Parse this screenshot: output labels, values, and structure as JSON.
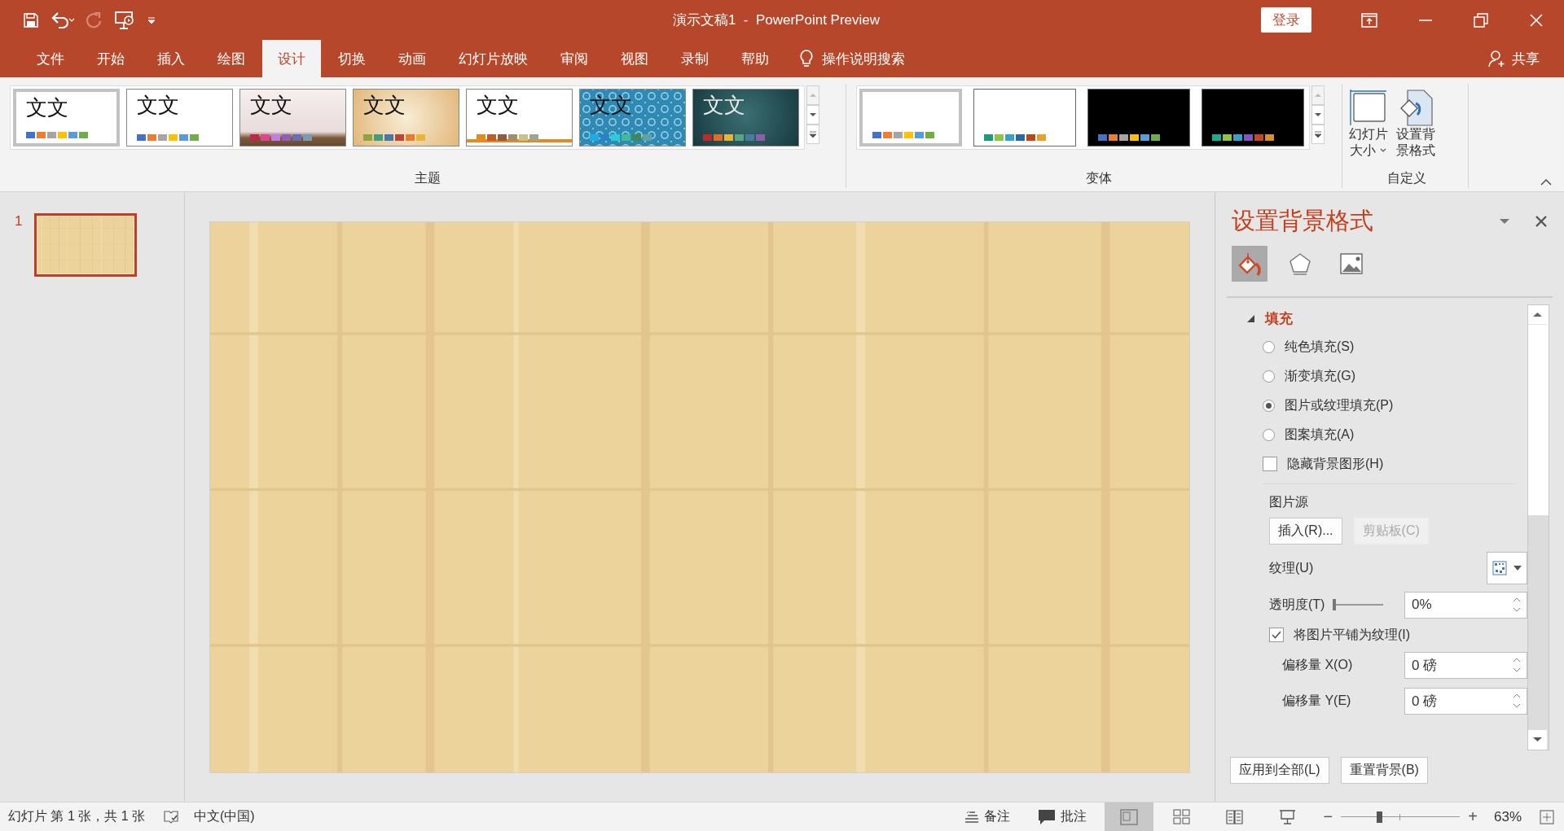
{
  "window": {
    "title": "演示文稿1  -  PowerPoint Preview",
    "sign_in": "登录"
  },
  "tabs": [
    {
      "label": "文件",
      "selected": false
    },
    {
      "label": "开始",
      "selected": false
    },
    {
      "label": "插入",
      "selected": false
    },
    {
      "label": "绘图",
      "selected": false
    },
    {
      "label": "设计",
      "selected": true
    },
    {
      "label": "切换",
      "selected": false
    },
    {
      "label": "动画",
      "selected": false
    },
    {
      "label": "幻灯片放映",
      "selected": false
    },
    {
      "label": "审阅",
      "selected": false
    },
    {
      "label": "视图",
      "selected": false
    },
    {
      "label": "录制",
      "selected": false
    },
    {
      "label": "帮助",
      "selected": false
    }
  ],
  "tell_me": "操作说明搜索",
  "share": "共享",
  "ribbon": {
    "themes": {
      "label": "主题",
      "items": [
        {
          "kind": "plain",
          "sample": "文文",
          "selected": true,
          "swatches": [
            {
              "color": "#4472c4"
            },
            {
              "color": "#ed7d31"
            },
            {
              "color": "#a5a5a5"
            },
            {
              "color": "#ffc000"
            },
            {
              "color": "#5b9bd5"
            },
            {
              "color": "#70ad47"
            }
          ]
        },
        {
          "kind": "plain",
          "sample": "文文",
          "selected": false,
          "swatches": [
            {
              "color": "#4472c4"
            },
            {
              "color": "#ed7d31"
            },
            {
              "color": "#a5a5a5"
            },
            {
              "color": "#ffc000"
            },
            {
              "color": "#5b9bd5"
            },
            {
              "color": "#70ad47"
            }
          ]
        },
        {
          "kind": "blush",
          "sample": "文文",
          "selected": false,
          "swatches": [
            {
              "color": "#c0264a"
            },
            {
              "color": "#e0468b"
            },
            {
              "color": "#c27ce8"
            },
            {
              "color": "#8e5fb5"
            },
            {
              "color": "#6a6fb5"
            },
            {
              "color": "#7d9bb0"
            }
          ]
        },
        {
          "kind": "tan",
          "sample": "文文",
          "selected": false,
          "swatches": [
            {
              "color": "#8da53a"
            },
            {
              "color": "#3f9e7d"
            },
            {
              "color": "#4a77a8"
            },
            {
              "color": "#b8473a"
            },
            {
              "color": "#e07f2e"
            },
            {
              "color": "#e8b53a"
            }
          ]
        },
        {
          "kind": "line",
          "sample": "文文",
          "selected": false,
          "swatches": [
            {
              "color": "#e58a1e"
            },
            {
              "color": "#c05a27"
            },
            {
              "color": "#8f5c40"
            },
            {
              "color": "#a58c6a"
            },
            {
              "color": "#c8c28a"
            },
            {
              "color": "#9ea58e"
            }
          ]
        },
        {
          "kind": "pattern",
          "sample": "文文",
          "selected": false,
          "swatches": [
            {
              "color": "#1cade4"
            },
            {
              "color": "#2683c6"
            },
            {
              "color": "#27ced7"
            },
            {
              "color": "#42ba97"
            },
            {
              "color": "#3e8853"
            },
            {
              "color": "#62a39f"
            }
          ]
        },
        {
          "kind": "teal",
          "sample": "文文",
          "selected": false,
          "swatches": [
            {
              "color": "#c0292a"
            },
            {
              "color": "#e06d22"
            },
            {
              "color": "#e8b53a"
            },
            {
              "color": "#5aa581"
            },
            {
              "color": "#4a7aa0"
            },
            {
              "color": "#8e5fa8"
            }
          ]
        }
      ]
    },
    "variants": {
      "label": "变体",
      "items": [
        {
          "kind": "light",
          "selected": true,
          "swatches": [
            {
              "color": "#4472c4"
            },
            {
              "color": "#ed7d31"
            },
            {
              "color": "#a5a5a5"
            },
            {
              "color": "#ffc000"
            },
            {
              "color": "#5b9bd5"
            },
            {
              "color": "#70ad47"
            }
          ]
        },
        {
          "kind": "light",
          "selected": false,
          "swatches": [
            {
              "color": "#1d9a78"
            },
            {
              "color": "#8dc63f"
            },
            {
              "color": "#35a2c8"
            },
            {
              "color": "#2269a8"
            },
            {
              "color": "#b8471e"
            },
            {
              "color": "#e8a02b"
            }
          ]
        },
        {
          "kind": "dark",
          "selected": false,
          "swatches": [
            {
              "color": "#4472c4"
            },
            {
              "color": "#ed7d31"
            },
            {
              "color": "#a5a5a5"
            },
            {
              "color": "#ffc000"
            },
            {
              "color": "#5b9bd5"
            },
            {
              "color": "#70ad47"
            }
          ]
        },
        {
          "kind": "dark",
          "selected": false,
          "swatches": [
            {
              "color": "#1cad8e"
            },
            {
              "color": "#8dc63f"
            },
            {
              "color": "#35a2c8"
            },
            {
              "color": "#7d58c0"
            },
            {
              "color": "#c0462c"
            },
            {
              "color": "#d98e2e"
            }
          ]
        }
      ]
    },
    "customize": {
      "label": "自定义",
      "buttons": [
        {
          "kind": "slide-size",
          "lines": [
            "幻灯片",
            "大小"
          ],
          "dropdown": true
        },
        {
          "kind": "format-background",
          "lines": [
            "设置背",
            "景格式"
          ],
          "dropdown": false
        }
      ]
    }
  },
  "slides": [
    {
      "number": "1",
      "selected": true
    }
  ],
  "slide": {
    "kind": "picture"
  },
  "pane": {
    "title": "设置背景格式",
    "icon_tabs": [
      {
        "kind": "fill",
        "selected": true
      },
      {
        "kind": "effects",
        "selected": false
      },
      {
        "kind": "picture",
        "selected": false
      }
    ],
    "section": {
      "label": "填充",
      "expanded": true
    },
    "options": [
      {
        "kind": "radio",
        "label": "纯色填充(S)",
        "selected": false
      },
      {
        "kind": "radio",
        "label": "渐变填充(G)",
        "selected": false
      },
      {
        "kind": "radio",
        "label": "图片或纹理填充(P)",
        "selected": true
      },
      {
        "kind": "radio",
        "label": "图案填充(A)",
        "selected": false
      },
      {
        "kind": "checkbox",
        "label": "隐藏背景图形(H)",
        "checked": false
      }
    ],
    "picture_source": {
      "label": "图片源",
      "buttons": [
        {
          "label": "插入(R)...",
          "disabled": false
        },
        {
          "label": "剪贴板(C)",
          "disabled": true
        }
      ]
    },
    "texture": {
      "label": "纹理(U)"
    },
    "transparency": {
      "label": "透明度(T)",
      "level": 0,
      "value": "0%"
    },
    "tile": {
      "label": "将图片平铺为纹理(I)",
      "checked": true
    },
    "offsets": [
      {
        "label": "偏移量 X(O)",
        "value": "0 磅"
      },
      {
        "label": "偏移量 Y(E)",
        "value": "0 磅"
      }
    ],
    "footer_buttons": [
      "应用到全部(L)",
      "重置背景(B)"
    ]
  },
  "status_bar": {
    "slide_info": "幻灯片 第 1 张，共 1 张",
    "language": "中文(中国)",
    "notes": "备注",
    "comments": "批注",
    "views": [
      {
        "kind": "normal",
        "selected": true
      },
      {
        "kind": "sorter",
        "selected": false
      },
      {
        "kind": "reading",
        "selected": false
      },
      {
        "kind": "slideshow",
        "selected": false
      }
    ],
    "zoom_out": "−",
    "zoom_in": "+",
    "zoom": {
      "level": 0.32
    },
    "zoom_value": "63%"
  }
}
